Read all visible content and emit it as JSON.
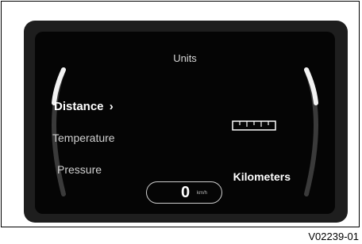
{
  "display": {
    "title": "Units",
    "menu": [
      {
        "label": "Distance",
        "chevron": "›",
        "active": true
      },
      {
        "label": "Temperature",
        "active": false
      },
      {
        "label": "Pressure",
        "active": false
      }
    ],
    "selected_value": "Kilometers",
    "value_icon": "ruler-icon",
    "speed": {
      "value": "0",
      "unit": "km/h"
    }
  },
  "figure_code": "V02239-01",
  "colors": {
    "bezel": "#1e1e1e",
    "display_bg": "#050505",
    "text": "#ffffff"
  }
}
